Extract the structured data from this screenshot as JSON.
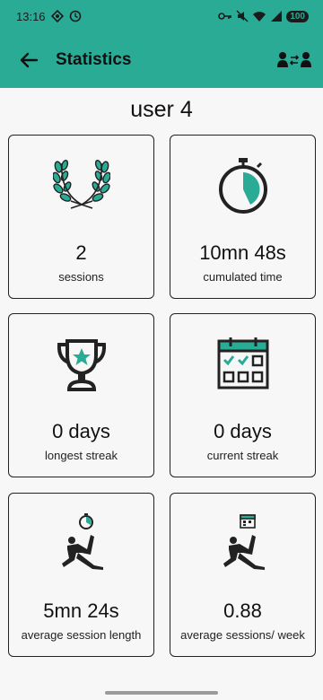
{
  "status_bar": {
    "time": "13:16",
    "battery": "100"
  },
  "app_bar": {
    "title": "Statistics"
  },
  "user": {
    "name": "user 4"
  },
  "stats": {
    "sessions": {
      "value": "2",
      "label": "sessions"
    },
    "cumulated_time": {
      "value": "10mn 48s",
      "label": "cumulated time"
    },
    "longest_streak": {
      "value": "0 days",
      "label": "longest streak"
    },
    "current_streak": {
      "value": "0 days",
      "label": "current streak"
    },
    "average_session_length": {
      "value": "5mn 24s",
      "label": "average session length"
    },
    "average_sessions_week": {
      "value": "0.88",
      "label": "average sessions/ week"
    }
  },
  "colors": {
    "accent": "#2aab96",
    "icon_fill": "#2aab96",
    "icon_stroke": "#222222"
  },
  "icons": [
    "back-arrow-icon",
    "switch-user-icon",
    "laurel-wreath-icon",
    "stopwatch-icon",
    "trophy-icon",
    "calendar-check-icon",
    "exercise-stopwatch-icon",
    "exercise-calendar-icon"
  ]
}
